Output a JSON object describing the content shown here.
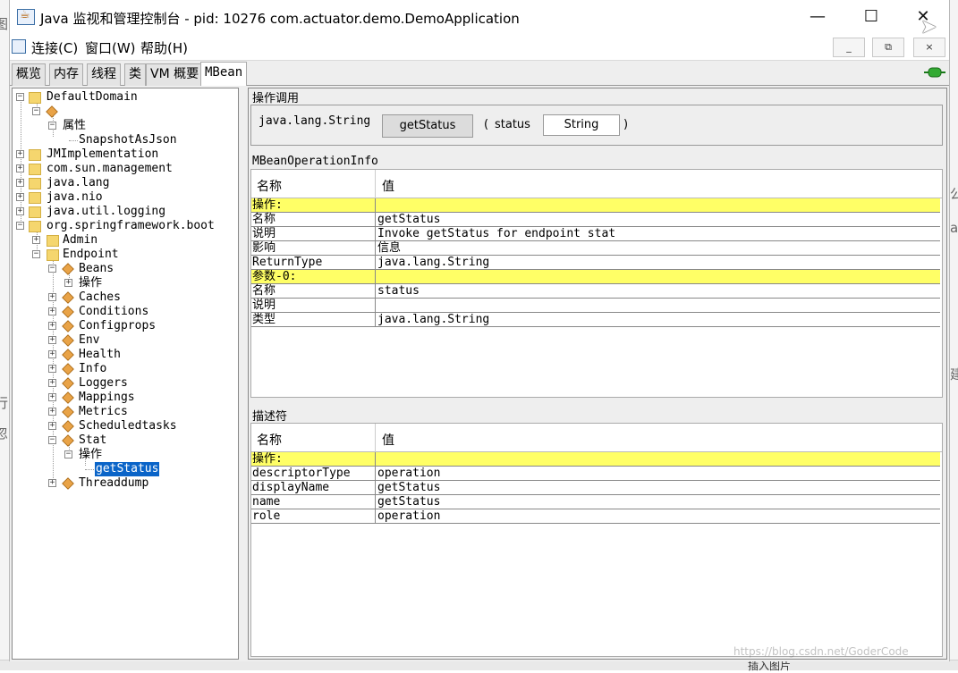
{
  "window": {
    "title": "Java 监视和管理控制台 - pid: 10276 com.actuator.demo.DemoApplication",
    "minimize": "—",
    "maximize": "☐",
    "close": "✕"
  },
  "menu": {
    "items": [
      "连接(C)",
      "窗口(W)",
      "帮助(H)"
    ],
    "inner_buttons": [
      "_",
      "⧉",
      "×"
    ]
  },
  "tabs": [
    {
      "label": "概览",
      "active": false
    },
    {
      "label": "内存",
      "active": false
    },
    {
      "label": "线程",
      "active": false
    },
    {
      "label": "类",
      "active": false
    },
    {
      "label": "VM 概要",
      "active": false
    },
    {
      "label": "MBean",
      "active": true
    }
  ],
  "tree": {
    "nodes": [
      {
        "label": "DefaultDomain"
      },
      {
        "label": ""
      },
      {
        "label": "属性"
      },
      {
        "label": "SnapshotAsJson"
      },
      {
        "label": "JMImplementation"
      },
      {
        "label": "com.sun.management"
      },
      {
        "label": "java.lang"
      },
      {
        "label": "java.nio"
      },
      {
        "label": "java.util.logging"
      },
      {
        "label": "org.springframework.boot"
      },
      {
        "label": "Admin"
      },
      {
        "label": "Endpoint"
      },
      {
        "label": "Beans"
      },
      {
        "label": "操作"
      },
      {
        "label": "Caches"
      },
      {
        "label": "Conditions"
      },
      {
        "label": "Configprops"
      },
      {
        "label": "Env"
      },
      {
        "label": "Health"
      },
      {
        "label": "Info"
      },
      {
        "label": "Loggers"
      },
      {
        "label": "Mappings"
      },
      {
        "label": "Metrics"
      },
      {
        "label": "Scheduledtasks"
      },
      {
        "label": "Stat"
      },
      {
        "label": "操作"
      },
      {
        "label": "getStatus"
      },
      {
        "label": "Threaddump"
      }
    ]
  },
  "operation": {
    "section_title": "操作调用",
    "return_type": "java.lang.String",
    "button_label": "getStatus",
    "lparen": "(",
    "param_name": "status",
    "param_type": "String",
    "rparen": ")"
  },
  "op_info": {
    "section_title": "MBeanOperationInfo",
    "col_name": "名称",
    "col_value": "值",
    "rows": [
      {
        "name": "操作:",
        "value": "",
        "highlight": true
      },
      {
        "name": "名称",
        "value": "getStatus"
      },
      {
        "name": "说明",
        "value": "Invoke getStatus for endpoint stat"
      },
      {
        "name": "影响",
        "value": "信息"
      },
      {
        "name": "ReturnType",
        "value": "java.lang.String"
      },
      {
        "name": "参数-0:",
        "value": "",
        "highlight": true
      },
      {
        "name": "名称",
        "value": "status"
      },
      {
        "name": "说明",
        "value": ""
      },
      {
        "name": "类型",
        "value": "java.lang.String"
      }
    ]
  },
  "descriptor": {
    "section_title": "描述符",
    "col_name": "名称",
    "col_value": "值",
    "rows": [
      {
        "name": "操作:",
        "value": "",
        "highlight": true
      },
      {
        "name": "descriptorType",
        "value": "operation"
      },
      {
        "name": "displayName",
        "value": "getStatus"
      },
      {
        "name": "name",
        "value": "getStatus"
      },
      {
        "name": "role",
        "value": "operation"
      }
    ]
  },
  "background": {
    "left_frags": [
      "图",
      "行",
      "忽"
    ],
    "right_frags": [
      "公",
      "ai",
      "建"
    ],
    "bottom_text": "插入图片"
  },
  "watermark": "https://blog.csdn.net/GoderCode"
}
